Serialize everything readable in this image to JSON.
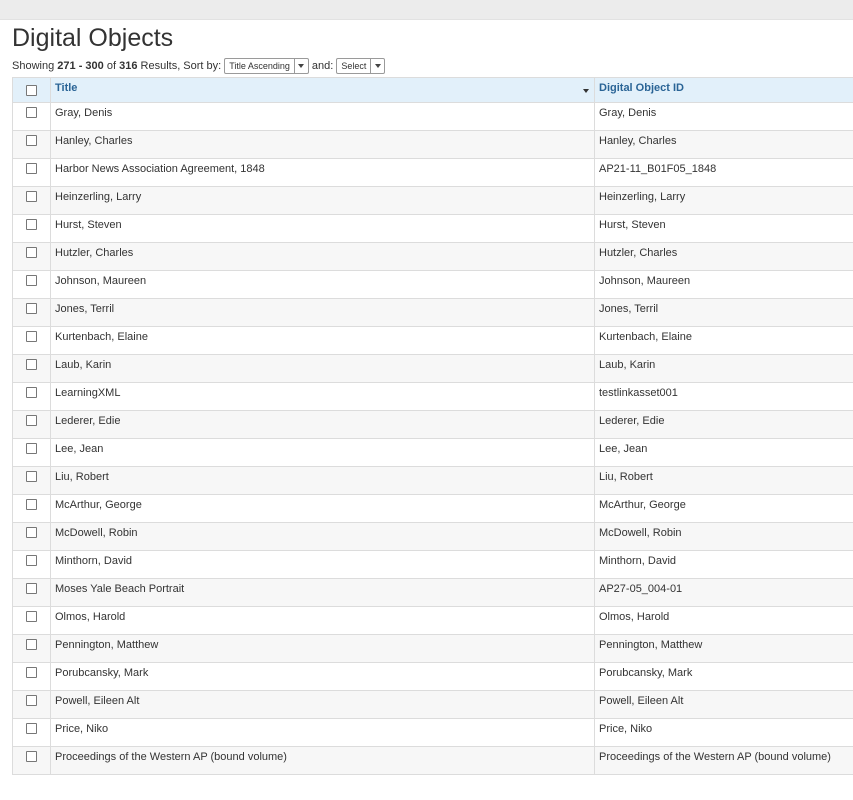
{
  "page": {
    "title": "Digital Objects"
  },
  "results": {
    "prefix": "Showing",
    "range_start": "271",
    "range_sep": "-",
    "range_end": "300",
    "of_text": "of",
    "total": "316",
    "results_sort_text": "Results, Sort by:",
    "sort_by_value": "Title Ascending",
    "and_text": "and:",
    "secondary_sort_value": "Select"
  },
  "table": {
    "columns": {
      "title": "Title",
      "digital_object_id": "Digital Object ID"
    },
    "rows": [
      {
        "title": "Gray, Denis",
        "id": "Gray, Denis"
      },
      {
        "title": "Hanley, Charles",
        "id": "Hanley, Charles"
      },
      {
        "title": "Harbor News Association Agreement, 1848",
        "id": "AP21-11_B01F05_1848"
      },
      {
        "title": "Heinzerling, Larry",
        "id": "Heinzerling, Larry"
      },
      {
        "title": "Hurst, Steven",
        "id": "Hurst, Steven"
      },
      {
        "title": "Hutzler, Charles",
        "id": "Hutzler, Charles"
      },
      {
        "title": "Johnson, Maureen",
        "id": "Johnson, Maureen"
      },
      {
        "title": "Jones, Terril",
        "id": "Jones, Terril"
      },
      {
        "title": "Kurtenbach, Elaine",
        "id": "Kurtenbach, Elaine"
      },
      {
        "title": "Laub, Karin",
        "id": "Laub, Karin"
      },
      {
        "title": "LearningXML",
        "id": "testlinkasset001"
      },
      {
        "title": "Lederer, Edie",
        "id": "Lederer, Edie"
      },
      {
        "title": "Lee, Jean",
        "id": "Lee, Jean"
      },
      {
        "title": "Liu, Robert",
        "id": "Liu, Robert"
      },
      {
        "title": "McArthur, George",
        "id": "McArthur, George"
      },
      {
        "title": "McDowell, Robin",
        "id": "McDowell, Robin"
      },
      {
        "title": "Minthorn, David",
        "id": "Minthorn, David"
      },
      {
        "title": "Moses Yale Beach Portrait",
        "id": "AP27-05_004-01"
      },
      {
        "title": "Olmos, Harold",
        "id": "Olmos, Harold"
      },
      {
        "title": "Pennington, Matthew",
        "id": "Pennington, Matthew"
      },
      {
        "title": "Porubcansky, Mark",
        "id": "Porubcansky, Mark"
      },
      {
        "title": "Powell, Eileen Alt",
        "id": "Powell, Eileen Alt"
      },
      {
        "title": "Price, Niko",
        "id": "Price, Niko"
      },
      {
        "title": "Proceedings of the Western AP (bound volume)",
        "id": "Proceedings of the Western AP (bound volume)"
      }
    ]
  },
  "icons": {
    "sort_dropdown": "caret-down-icon",
    "column_sort": "sort-desc-icon",
    "row_select": "checkbox"
  },
  "colors": {
    "header_bg": "#e2f0fa",
    "header_text": "#2a6496",
    "row_alt_bg": "#f7f7f7"
  }
}
